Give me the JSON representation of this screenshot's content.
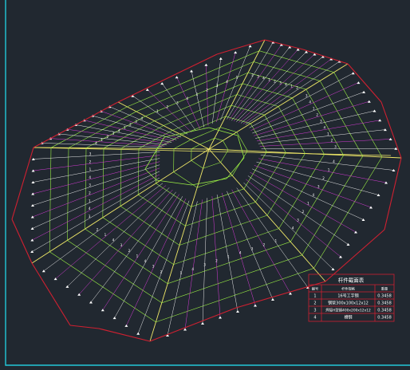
{
  "drawing": {
    "background": "#212830",
    "colors": {
      "frame": "#22c8d8",
      "outline": "#d02030",
      "ridge": "#f0e868",
      "rib": "#9aee44",
      "purlin_magenta": "#d83cd8",
      "purlin_white": "#e8e8e8",
      "marker": "#ffffff"
    },
    "member_labels": [
      "1",
      "2",
      "3",
      "4"
    ]
  },
  "table": {
    "title": "杆件截面表",
    "headers": [
      "编号",
      "杆件规格",
      "重量"
    ],
    "rows": [
      {
        "no": "1",
        "spec": "16号工字钢",
        "weight": "0.3458"
      },
      {
        "no": "2",
        "spec": "钢管300x100x12x12",
        "weight": "0.3458"
      },
      {
        "no": "3",
        "spec": "焊接H型钢400x200x12x12",
        "weight": "0.3458"
      },
      {
        "no": "4",
        "spec": "槽钢",
        "weight": "0.3458"
      }
    ]
  }
}
